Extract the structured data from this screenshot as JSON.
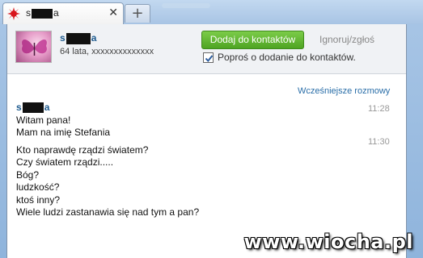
{
  "tab": {
    "title_prefix": "s",
    "title_suffix": "a",
    "close_glyph": "✕",
    "new_tab_glyph": "+",
    "icon": "red-sun-icon"
  },
  "contact": {
    "name_prefix": "s",
    "name_suffix": "a",
    "subtitle": "64 lata, xxxxxxxxxxxxxx",
    "avatar": "butterfly-avatar"
  },
  "actions": {
    "add_label": "Dodaj do kontaktów",
    "ignore_label": "Ignoruj/zgłoś",
    "ask_label": "Poproś o dodanie do kontaktów.",
    "ask_checked": true
  },
  "chat": {
    "earlier_label": "Wcześniejsze rozmowy",
    "sender_prefix": "s",
    "sender_suffix": "a",
    "groups": [
      {
        "time": "11:28",
        "lines": [
          "Witam pana!",
          "Mam na imię Stefania"
        ]
      },
      {
        "time": "11:30",
        "lines": [
          "Kto naprawdę rządzi światem?",
          "Czy światem rządzi.....",
          "Bóg?",
          "ludzkość?",
          "ktoś inny?",
          "Wiele ludzi zastanawia się nad tym a pan?"
        ]
      }
    ]
  },
  "watermark": "www.wiocha.pl",
  "colors": {
    "accent_green": "#4ea422",
    "link_blue": "#2a6ea8",
    "name_blue": "#1e5b8f"
  }
}
